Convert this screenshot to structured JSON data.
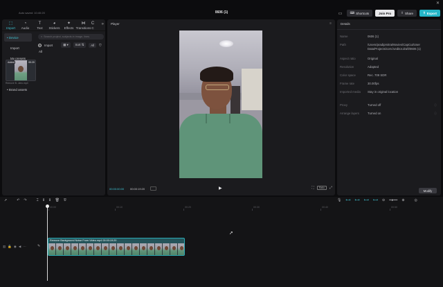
{
  "titlebar": {
    "autosave": "Auto saved: 10:40:20",
    "project_title": "0606 (1)",
    "shortcuts": "Shortcuts",
    "join_pro": "Join Pro",
    "share": "Share",
    "export": "Export"
  },
  "media": {
    "tabs": [
      {
        "label": "Import",
        "icon": "import-icon"
      },
      {
        "label": "Audio",
        "icon": "audio-icon"
      },
      {
        "label": "Text",
        "icon": "text-icon"
      },
      {
        "label": "Stickers",
        "icon": "stickers-icon"
      },
      {
        "label": "Effects",
        "icon": "effects-icon"
      },
      {
        "label": "Transitions",
        "icon": "transitions-icon"
      },
      {
        "label": "C",
        "icon": "captions-icon"
      }
    ],
    "sidebar": [
      {
        "label": "• Device"
      },
      {
        "label": "Import"
      },
      {
        "label": "My presets"
      },
      {
        "label": "Spaces"
      },
      {
        "label": "Stock mate..."
      },
      {
        "label": "• Brand assets"
      }
    ],
    "search_placeholder": "Search project, subjects in image, lines",
    "import_label": "Import",
    "sort_label": "Sort",
    "all_filter": "All",
    "all_label": "All",
    "clip": {
      "added": "Added",
      "duration": "00:20",
      "name": "Remove B...ideo.mp4"
    }
  },
  "player": {
    "title": "Player",
    "time_current": "00:00:00:00",
    "time_total": "00:00:19:20",
    "ratio": "Ratio"
  },
  "details": {
    "title": "Details",
    "rows": [
      {
        "key": "Name",
        "value": "0606 (1)"
      },
      {
        "key": "Path",
        "value": "/Users/pradipmitra/Movies/CapCut/User Data/Projects/com.lveditor.draft/0606 (1)"
      },
      {
        "key": "Aspect ratio",
        "value": "Original"
      },
      {
        "key": "Resolution",
        "value": "Adapted"
      },
      {
        "key": "Color space",
        "value": "Rec. 709 SDR"
      },
      {
        "key": "Frame rate",
        "value": "30.00fps"
      },
      {
        "key": "Imported media",
        "value": "Stay in original location"
      },
      {
        "key": "Proxy",
        "value": "Turned off"
      },
      {
        "key": "Arrange layers",
        "value": "Turned on"
      }
    ],
    "modify": "Modify"
  },
  "timeline": {
    "ticks": [
      "00:00",
      "00:10",
      "00:20",
      "00:30",
      "00:40",
      "00:50"
    ],
    "clip_label": "Remove Background Noise From Video.mp4  00:00:19:20"
  }
}
